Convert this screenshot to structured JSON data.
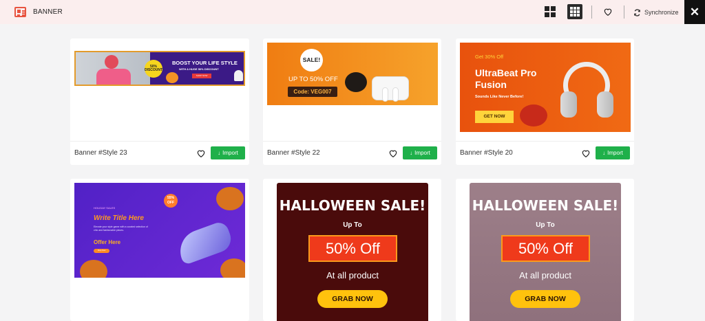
{
  "header": {
    "title": "BANNER",
    "sync_label": "Synchronize",
    "close_glyph": "✕"
  },
  "cards": [
    {
      "title": "Banner #Style 23",
      "import_label": "Import",
      "banner": {
        "headline": "BOOST YOUR LIFE STYLE",
        "sub": "WITH A HUGE 50% DISCOUNT",
        "badge": "50% DISCOUNT",
        "button": "SHOP NOW"
      }
    },
    {
      "title": "Banner #Style 22",
      "import_label": "Import",
      "banner": {
        "sale": "SALE!",
        "offer": "UP TO 50% OFF",
        "code": "Code: VEG007"
      }
    },
    {
      "title": "Banner #Style 20",
      "import_label": "Import",
      "banner": {
        "get": "Get 30% Off",
        "headline": "UltraBeat Pro Fusion",
        "sub": "Sounds Like Never Before!",
        "button": "GET NOW"
      }
    },
    {
      "banner": {
        "tag": "HOLIDAY SALES",
        "headline": "Write Title Here",
        "paragraph": "Elevate your style game with a curated selection of chic and fashionable pieces.",
        "offer": "Offer Here",
        "button": "Shop Now",
        "discount": "55% OFF"
      }
    },
    {
      "banner": {
        "headline": "HALLOWEEN SALE!",
        "upto": "Up To",
        "percent": "50% Off",
        "line": "At all product",
        "button": "GRAB NOW"
      }
    },
    {
      "banner": {
        "headline": "HALLOWEEN SALE!",
        "upto": "Up To",
        "percent": "50% Off",
        "line": "At all product",
        "button": "GRAB NOW"
      }
    }
  ],
  "colors": {
    "accent": "#e8533f",
    "import_green": "#1fb04a",
    "hw1_bg": "#4a0b0b",
    "hw2_bg": "#9a7b86"
  }
}
